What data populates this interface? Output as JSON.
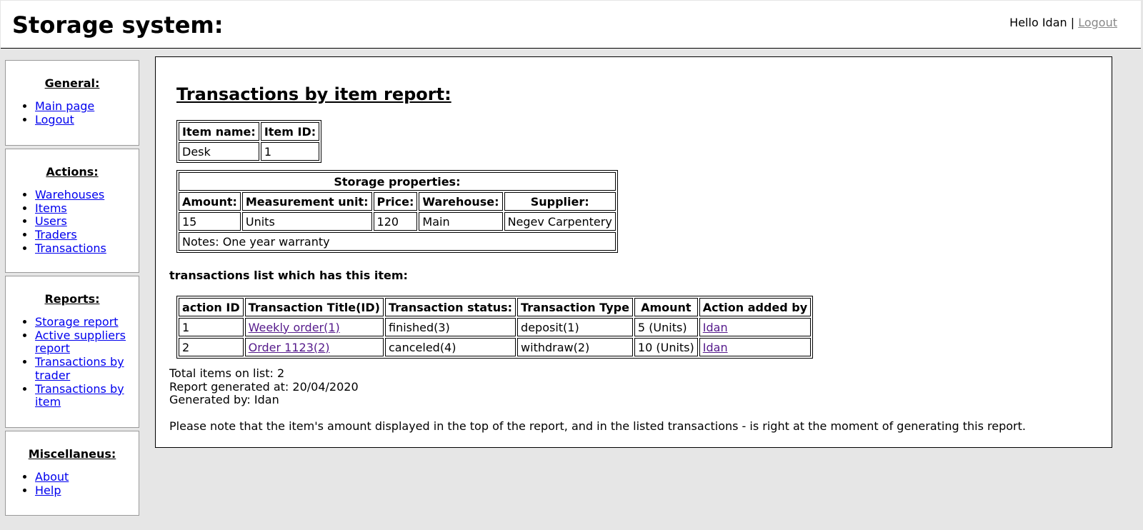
{
  "header": {
    "title": "Storage system:",
    "greeting": "Hello Idan",
    "separator": "|",
    "logout": "Logout"
  },
  "sidebar": {
    "general": {
      "title": "General:",
      "items": [
        "Main page",
        "Logout"
      ]
    },
    "actions": {
      "title": "Actions:",
      "items": [
        "Warehouses",
        "Items",
        "Users",
        "Traders",
        "Transactions"
      ]
    },
    "reports": {
      "title": "Reports:",
      "items": [
        "Storage report",
        "Active suppliers report",
        "Transactions by trader",
        "Transactions by item"
      ]
    },
    "misc": {
      "title": "Miscellaneus:",
      "items": [
        "About",
        "Help"
      ]
    }
  },
  "main": {
    "title": "Transactions by item report:",
    "item_table": {
      "headers": [
        "Item name:",
        "Item ID:"
      ],
      "row": [
        "Desk",
        "1"
      ]
    },
    "storage_table": {
      "caption": "Storage properties:",
      "headers": [
        "Amount:",
        "Measurement unit:",
        "Price:",
        "Warehouse:",
        "Supplier:"
      ],
      "row": [
        "15",
        "Units",
        "120",
        "Main",
        "Negev Carpentery"
      ],
      "notes": "Notes: One year warranty"
    },
    "transactions_title": "transactions list which has this item:",
    "transactions_table": {
      "headers": [
        "action ID",
        "Transaction Title(ID)",
        "Transaction status:",
        "Transaction Type",
        "Amount",
        "Action added by"
      ],
      "rows": [
        {
          "id": "1",
          "title": "Weekly order(1)",
          "status": "finished(3)",
          "type": "deposit(1)",
          "amount": "5 (Units)",
          "by": "Idan"
        },
        {
          "id": "2",
          "title": "Order 1123(2)",
          "status": "canceled(4)",
          "type": "withdraw(2)",
          "amount": "10 (Units)",
          "by": "Idan"
        }
      ]
    },
    "total": "Total items on list: 2",
    "generated_at": "Report generated at: 20/04/2020",
    "generated_by": "Generated by: Idan",
    "note": "Please note that the item's amount displayed in the top of the report, and in the listed transactions - is right at the moment of generating this report."
  }
}
